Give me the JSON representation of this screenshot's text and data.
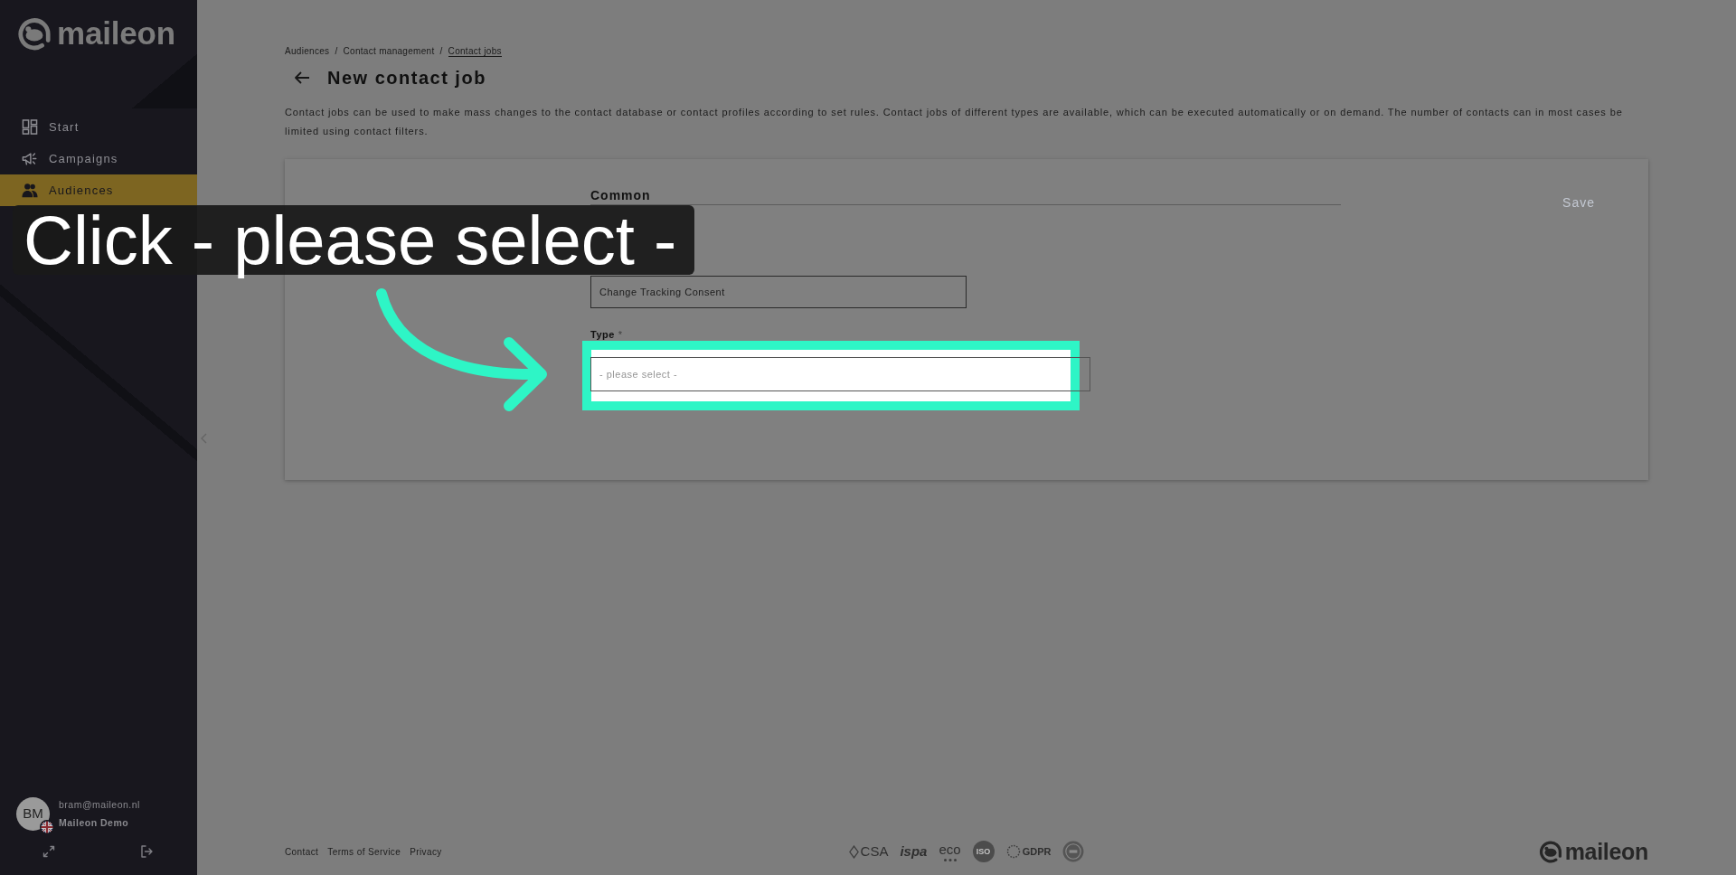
{
  "sidebar": {
    "logo_text": "maileon",
    "items": [
      {
        "label": "Start",
        "selected": false
      },
      {
        "label": "Campaigns",
        "selected": false
      },
      {
        "label": "Audiences",
        "selected": true
      }
    ],
    "user": {
      "initials": "BM",
      "email": "bram@maileon.nl",
      "account": "Maileon Demo"
    }
  },
  "breadcrumb": [
    {
      "label": "Audiences",
      "separator": "/",
      "selected": false
    },
    {
      "label": "Contact management",
      "separator": "/",
      "selected": false
    },
    {
      "label": "Contact jobs",
      "selected": true
    }
  ],
  "page": {
    "title": "New contact job",
    "description": "Contact jobs can be used to make mass changes to the contact database or contact profiles according to set rules. Contact jobs of different types are available, which can be executed automatically or on demand. The number of contacts can in most cases be limited using contact filters."
  },
  "card": {
    "section_title": "Common",
    "save_button": {
      "label": "Save",
      "disabled": true
    },
    "fields": [
      {
        "kind": "text",
        "value": "Change Tracking Consent",
        "highlighted": false
      },
      {
        "kind": "select",
        "label": "Type",
        "required_mark": "*",
        "placeholder": "- please select -",
        "highlighted": true
      }
    ]
  },
  "footer": {
    "links": [
      "Contact",
      "Terms of Service",
      "Privacy"
    ],
    "certifications": [
      {
        "label": "CSA",
        "kind": "diamond"
      },
      {
        "label": "ispa",
        "kind": "italic"
      },
      {
        "label": "eco",
        "kind": "dotted"
      },
      {
        "label": "ISO",
        "kind": "disc"
      },
      {
        "label": "GDPR",
        "kind": "ring"
      }
    ],
    "logo_text": "maileon"
  },
  "tutorial_overlay": {
    "caption": "Click - please select -"
  }
}
